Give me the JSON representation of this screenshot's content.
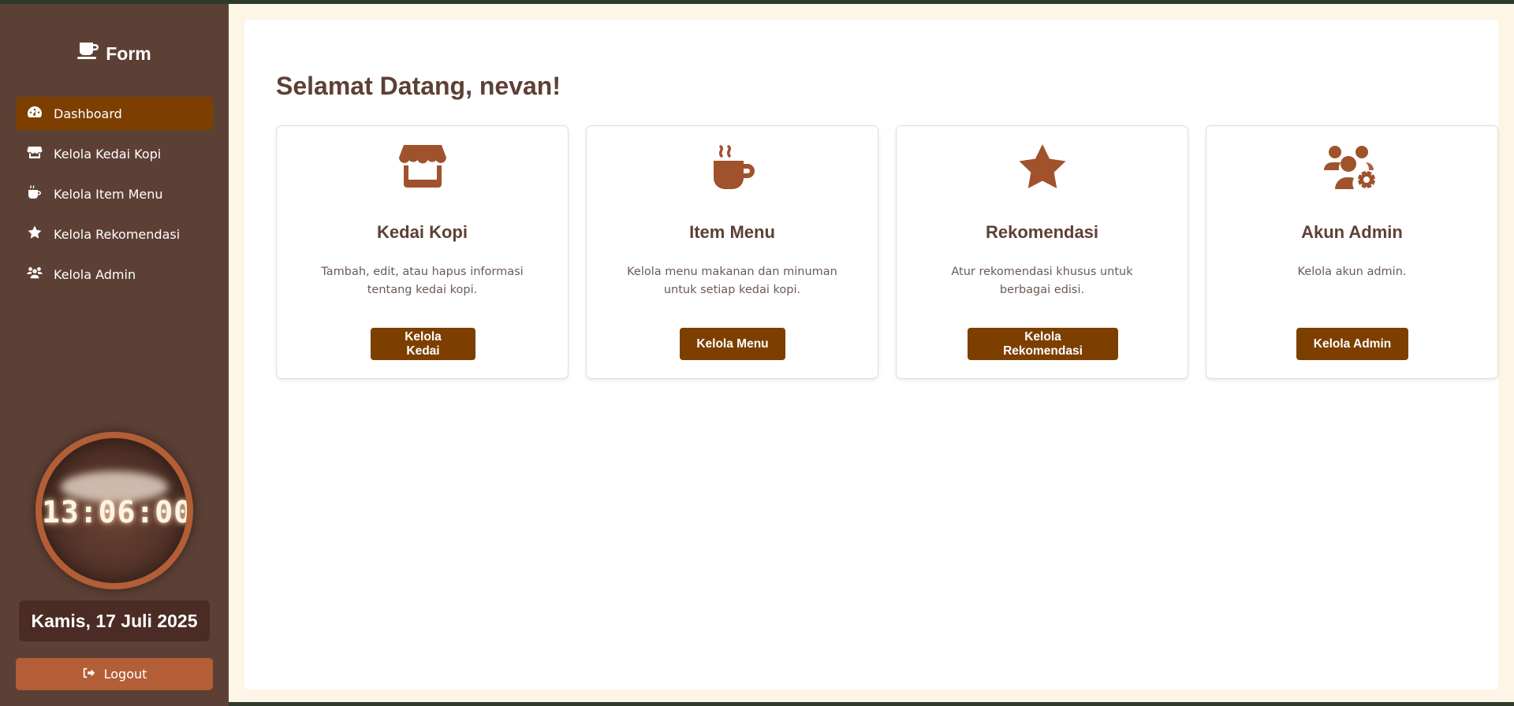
{
  "brand": {
    "title": "Form",
    "icon": "coffee-cup-icon"
  },
  "sidebar": {
    "items": [
      {
        "label": "Dashboard",
        "icon": "gauge-icon",
        "active": true
      },
      {
        "label": "Kelola Kedai Kopi",
        "icon": "store-icon",
        "active": false
      },
      {
        "label": "Kelola Item Menu",
        "icon": "mug-icon",
        "active": false
      },
      {
        "label": "Kelola Rekomendasi",
        "icon": "star-icon",
        "active": false
      },
      {
        "label": "Kelola Admin",
        "icon": "users-icon",
        "active": false
      }
    ],
    "clock_time": "13:06:00",
    "date": "Kamis, 17 Juli 2025",
    "logout_label": "Logout"
  },
  "main": {
    "welcome": "Selamat Datang, nevan!",
    "cards": [
      {
        "title": "Kedai Kopi",
        "description": "Tambah, edit, atau hapus informasi tentang kedai kopi.",
        "button": "Kelola Kedai",
        "icon": "store-icon"
      },
      {
        "title": "Item Menu",
        "description": "Kelola menu makanan dan minuman untuk setiap kedai kopi.",
        "button": "Kelola Menu",
        "icon": "mug-hot-icon"
      },
      {
        "title": "Rekomendasi",
        "description": "Atur rekomendasi khusus untuk berbagai edisi.",
        "button": "Kelola Rekomendasi",
        "icon": "star-icon"
      },
      {
        "title": "Akun Admin",
        "description": "Kelola akun admin.",
        "button": "Kelola Admin",
        "icon": "users-gear-icon"
      }
    ]
  },
  "colors": {
    "sidebar_bg": "#5d4035",
    "accent": "#7c3f00",
    "logout_bg": "#b35e37",
    "icon_color": "#a0522d",
    "main_bg": "#fdf5e6"
  }
}
